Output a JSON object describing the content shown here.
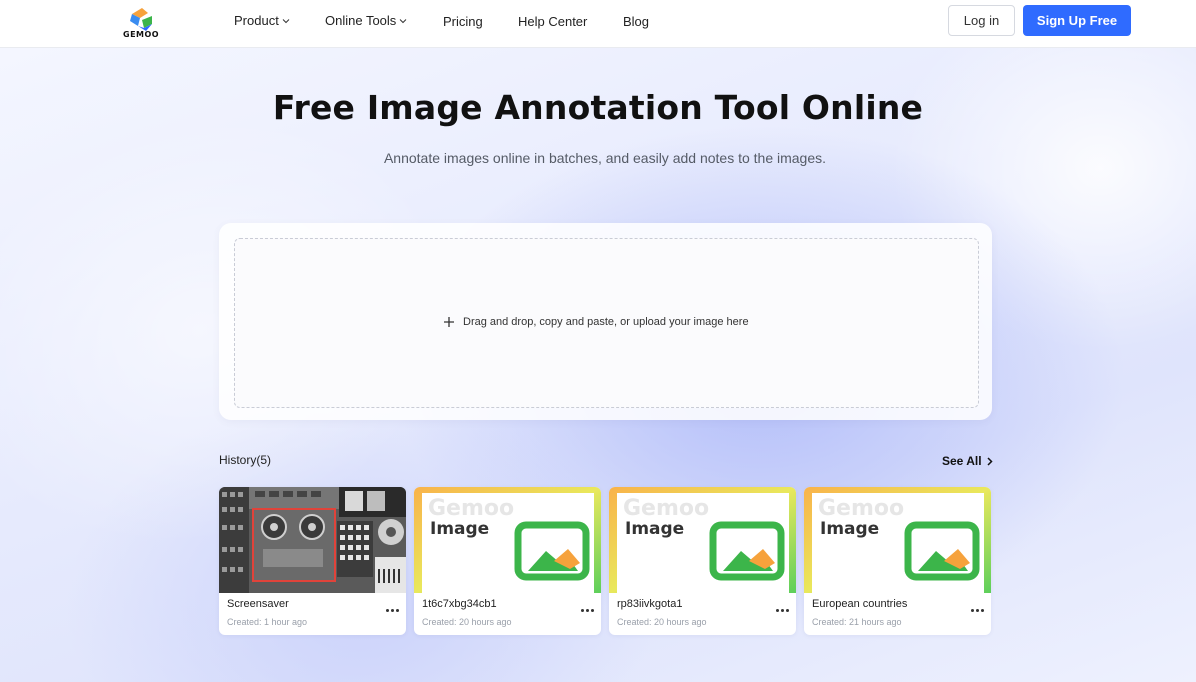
{
  "header": {
    "logo_text": "GEMOO",
    "nav": [
      {
        "label": "Product",
        "has_dropdown": true
      },
      {
        "label": "Online Tools",
        "has_dropdown": true
      },
      {
        "label": "Pricing",
        "has_dropdown": false
      },
      {
        "label": "Help Center",
        "has_dropdown": false
      },
      {
        "label": "Blog",
        "has_dropdown": false
      }
    ],
    "login_label": "Log in",
    "signup_label": "Sign Up Free"
  },
  "hero": {
    "title": "Free Image Annotation Tool Online",
    "subtitle": "Annotate images online in batches, and easily add notes to the images."
  },
  "upload": {
    "prompt": "Drag and drop, copy and paste, or upload your image here"
  },
  "history": {
    "label": "History(5)",
    "see_all": "See All",
    "items": [
      {
        "name": "Screensaver",
        "created": "Created: 1 hour ago",
        "thumb": "photo"
      },
      {
        "name": "1t6c7xbg34cb1",
        "created": "Created: 20 hours ago",
        "thumb": "placeholder"
      },
      {
        "name": "rp83iivkgota1",
        "created": "Created: 20 hours ago",
        "thumb": "placeholder"
      },
      {
        "name": "European countries",
        "created": "Created: 21 hours ago",
        "thumb": "placeholder"
      }
    ],
    "placeholder_brand": "Gemoo",
    "placeholder_word": "Image"
  },
  "colors": {
    "primary": "#2f6bff",
    "placeholder_green": "#3cb54a",
    "placeholder_orange": "#f6a23c"
  }
}
